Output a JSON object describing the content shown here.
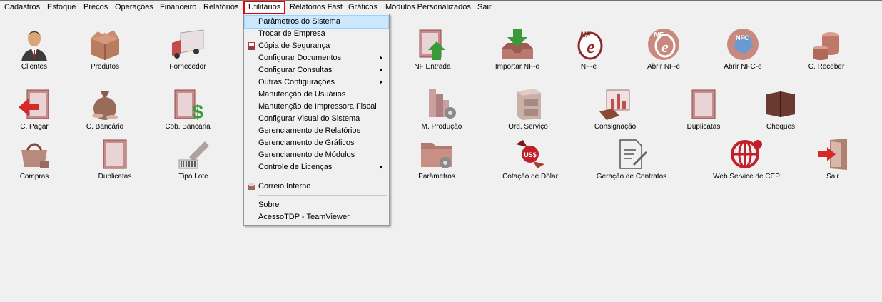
{
  "menubar": {
    "items": [
      "Cadastros",
      "Estoque",
      "Preços",
      "Operações",
      "Financeiro",
      "Relatórios",
      "Utilitários",
      "Relatórios Fast",
      "Gráficos",
      "Módulos Personalizados",
      "Sair"
    ]
  },
  "grid": {
    "clientes": "Clientes",
    "produtos": "Produtos",
    "fornecedor": "Fornecedor",
    "nf_entrada": "NF Entrada",
    "importar_nfe": "Importar NF-e",
    "nfe": "NF-e",
    "abrir_nfe": "Abrir NF-e",
    "abrir_nfce": "Abrir NFC-e",
    "c_receber": "C. Receber",
    "c_pagar": "C. Pagar",
    "c_bancario": "C. Bancário",
    "cob_bancaria": "Cob. Bancária",
    "m_producao": "M. Produção",
    "ord_servico": "Ord. Serviço",
    "consignacao": "Consignação",
    "duplicatas_1": "Duplicatas",
    "cheques": "Cheques",
    "compras": "Compras",
    "duplicatas_2": "Duplicatas",
    "tipo_lote": "Tipo Lote",
    "parametros": "Parâmetros",
    "cotacao_dolar": "Cotação de Dólar",
    "geracao_contratos": "Geração de Contratos",
    "web_service_cep": "Web Service de CEP",
    "sair": "Sair"
  },
  "icon_text": {
    "nfe_badge": "NF",
    "nfce_badge": "NFC",
    "usd_badge": "US$",
    "dollar_sign": "$"
  },
  "dropdown": {
    "items": [
      {
        "label": "Parâmetros do Sistema",
        "submenu": false
      },
      {
        "label": "Trocar de Empresa",
        "submenu": false
      },
      {
        "label": "Cópia de Segurança",
        "submenu": false
      },
      {
        "label": "Configurar Documentos",
        "submenu": true
      },
      {
        "label": "Configurar Consultas",
        "submenu": true
      },
      {
        "label": "Outras Configurações",
        "submenu": true
      },
      {
        "label": "Manutenção de Usuários",
        "submenu": false
      },
      {
        "label": "Manutenção de Impressora Fiscal",
        "submenu": false
      },
      {
        "label": "Configurar Visual do Sistema",
        "submenu": false
      },
      {
        "label": "Gerenciamento de Relatórios",
        "submenu": false
      },
      {
        "label": "Gerenciamento de Gráficos",
        "submenu": false
      },
      {
        "label": "Gerenciamento de Módulos",
        "submenu": false
      },
      {
        "label": "Controle de Licenças",
        "submenu": true
      },
      {
        "label": "Correio Interno",
        "submenu": false
      },
      {
        "label": "Sobre",
        "submenu": false
      },
      {
        "label": "AcessoTDP - TeamViewer",
        "submenu": false
      }
    ]
  },
  "colors": {
    "accent_red": "#e3000f",
    "icon_red": "#c0393b",
    "icon_green": "#3a9a3a",
    "selection": "#cce8ff"
  }
}
